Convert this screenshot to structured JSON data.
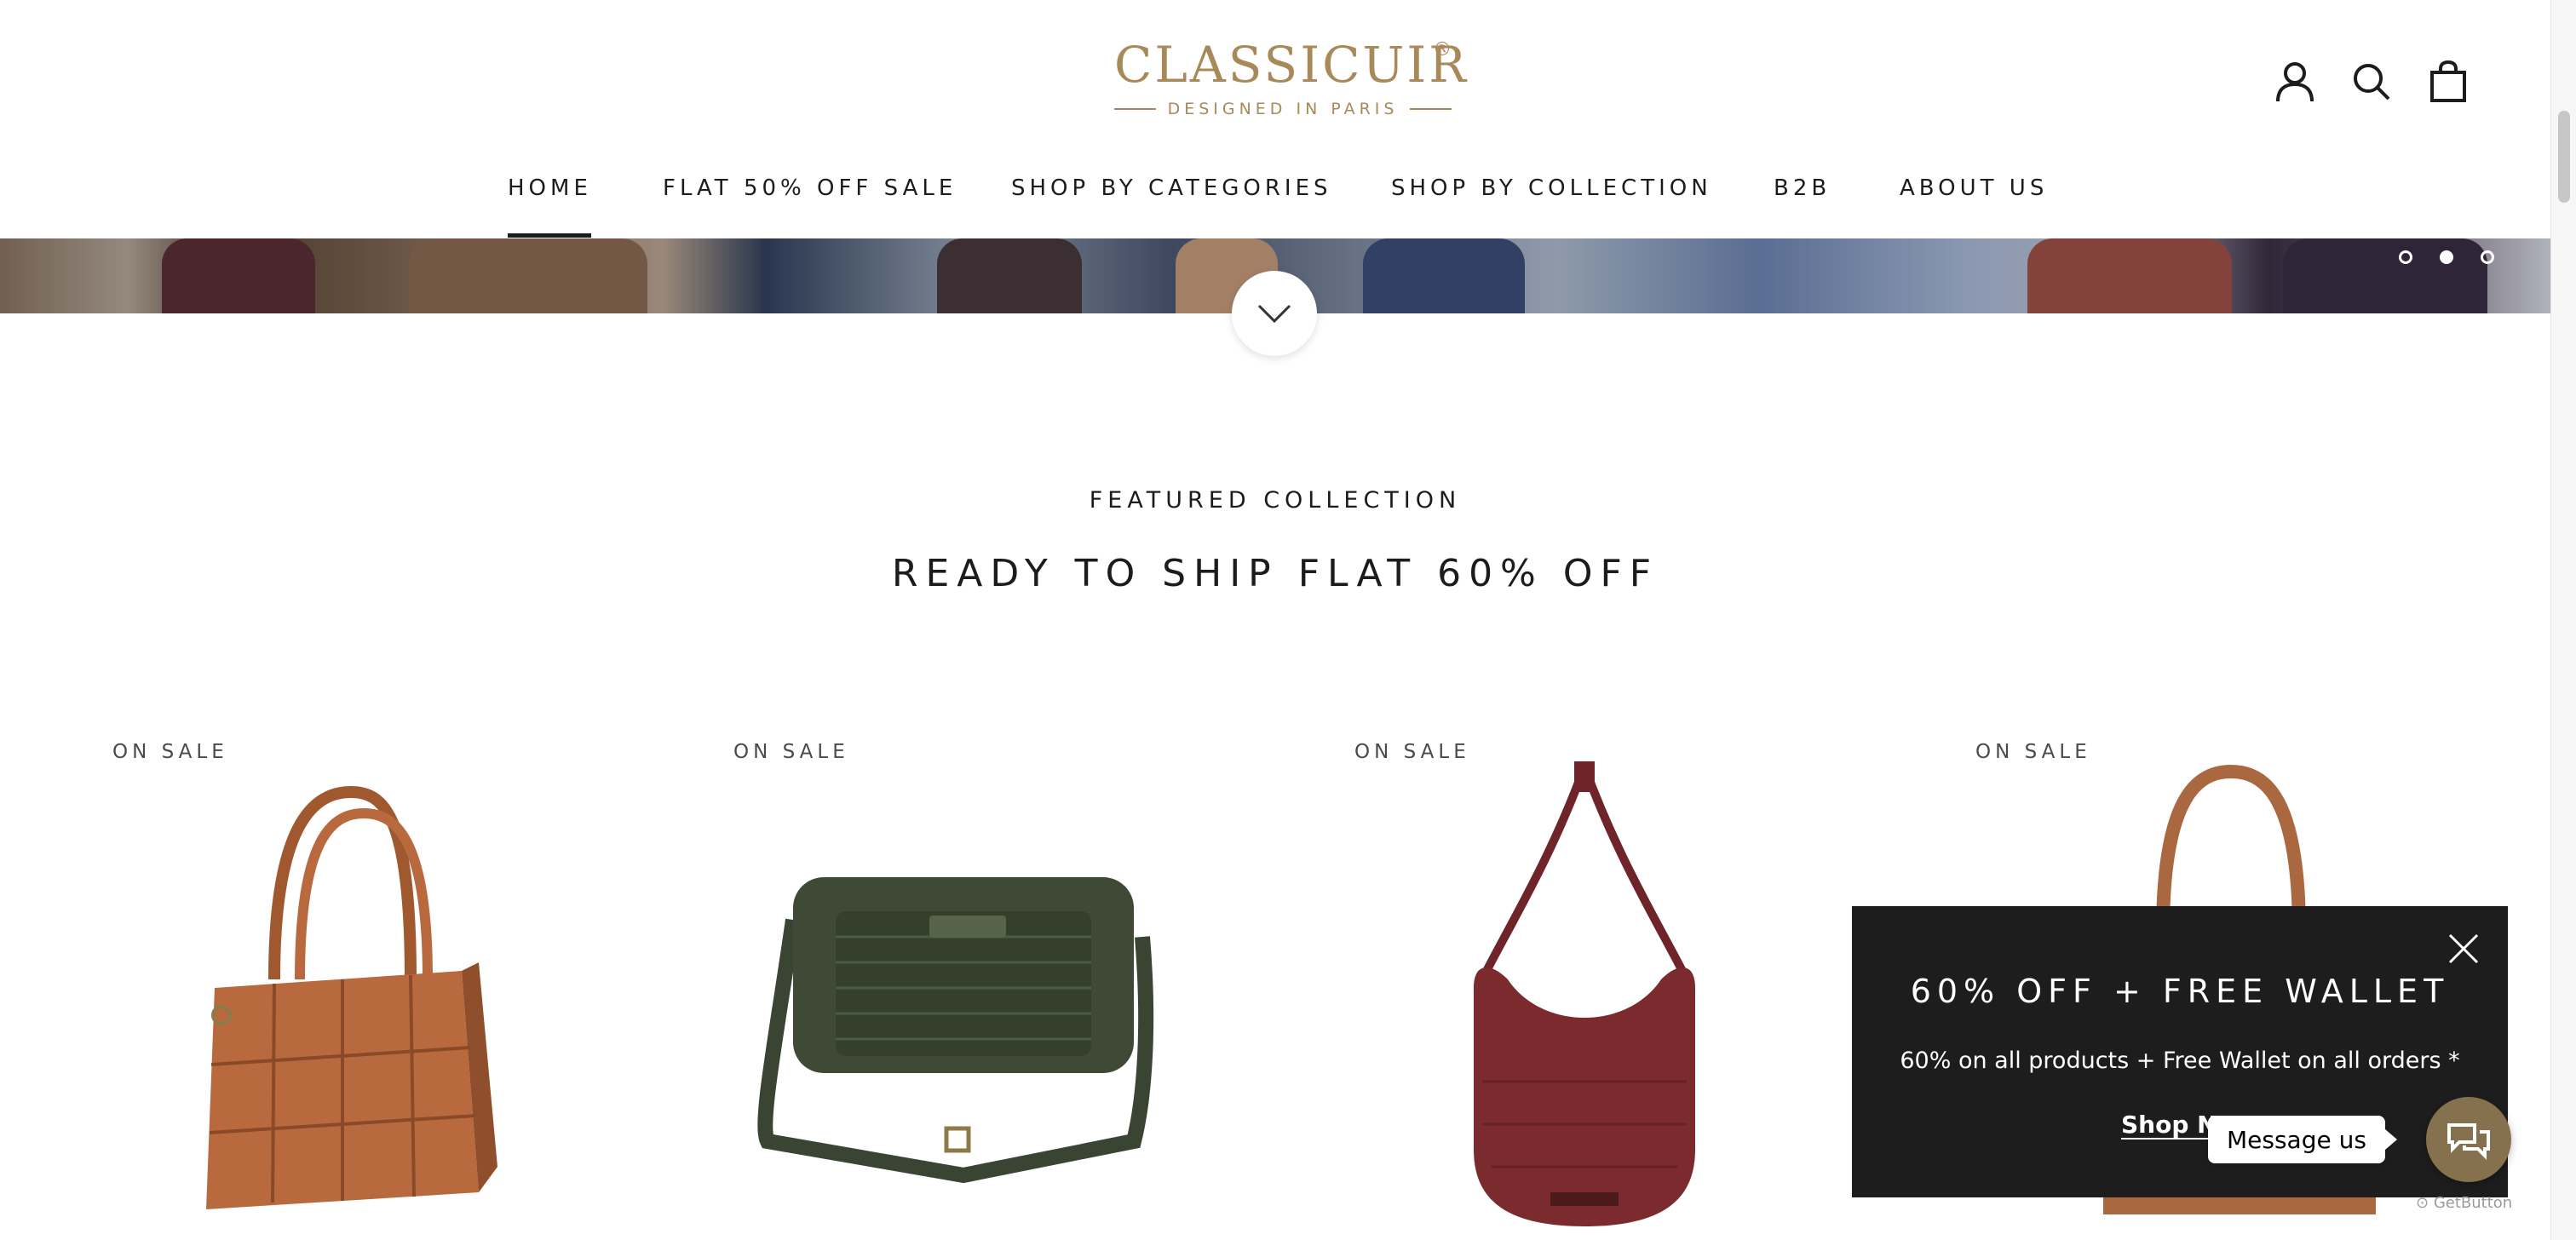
{
  "brand": {
    "name": "CLASSICUIR",
    "registered_mark": "®",
    "tagline": "DESIGNED IN PARIS",
    "color": "#a8895a"
  },
  "header": {
    "icons": [
      "account-icon",
      "search-icon",
      "cart-icon"
    ]
  },
  "nav": {
    "items": [
      {
        "label": "HOME",
        "active": true
      },
      {
        "label": "FLAT 50% OFF SALE",
        "active": false
      },
      {
        "label": "SHOP BY CATEGORIES",
        "active": false
      },
      {
        "label": "SHOP BY COLLECTION",
        "active": false
      },
      {
        "label": "B2B",
        "active": false
      },
      {
        "label": "ABOUT US",
        "active": false
      }
    ]
  },
  "hero": {
    "slide_count": 3,
    "active_slide": 2
  },
  "section": {
    "eyebrow": "FEATURED COLLECTION",
    "title": "READY TO SHIP FLAT 60% OFF"
  },
  "products": [
    {
      "badge": "ON SALE",
      "color": "#b8693e"
    },
    {
      "badge": "ON SALE",
      "color": "#3f4a36"
    },
    {
      "badge": "ON SALE",
      "color": "#7b2a2d"
    },
    {
      "badge": "ON SALE",
      "color": "#a9683f"
    }
  ],
  "popup": {
    "title": "60% OFF + FREE WALLET",
    "text": "60% on all products + Free Wallet on all orders *",
    "link": "Shop Now"
  },
  "chat": {
    "bubble": "Message us",
    "credit": "GetButton",
    "color": "#86714f"
  }
}
